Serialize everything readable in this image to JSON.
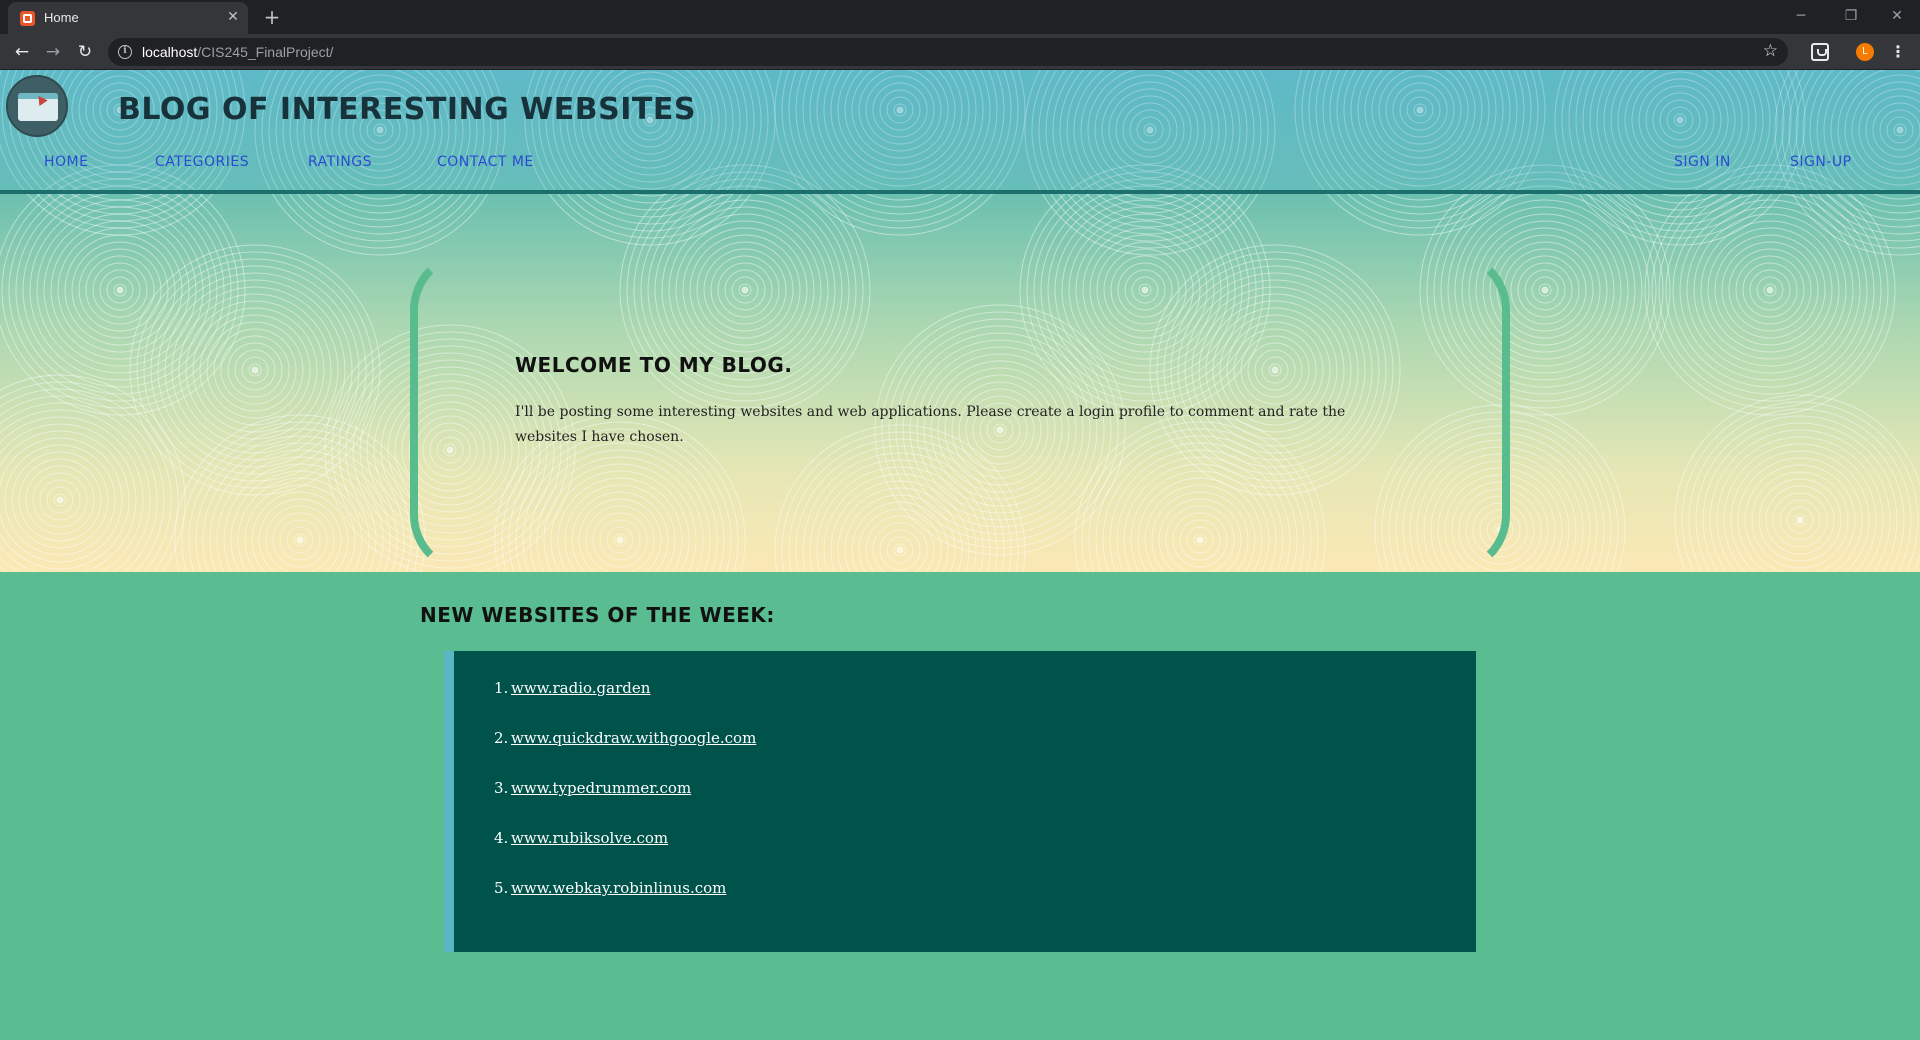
{
  "browser": {
    "tab_title": "Home",
    "tab_close": "✕",
    "new_tab": "+",
    "url_host": "localhost",
    "url_path": "/CIS245_FinalProject/",
    "profile_initial": "L",
    "win_minimize": "─",
    "win_restore": "❐",
    "win_close": "✕",
    "icons": {
      "back": "←",
      "forward": "→",
      "reload": "↻",
      "info": "i",
      "star": "☆",
      "menu": "⋮"
    }
  },
  "site": {
    "title": "BLOG OF INTERESTING WEBSITES",
    "nav_left": [
      "HOME",
      "CATEGORIES",
      "RATINGS",
      "CONTACT ME"
    ],
    "nav_right": [
      "SIGN IN",
      "SIGN-UP"
    ]
  },
  "welcome": {
    "heading": "WELCOME TO MY BLOG.",
    "text": "I'll be posting some interesting websites and web applications. Please create a login profile to comment and rate the websites I have chosen."
  },
  "new_sites": {
    "heading": "NEW WEBSITES OF THE WEEK:",
    "items": [
      {
        "num": "1.",
        "url": "www.radio.garden"
      },
      {
        "num": "2.",
        "url": "www.quickdraw.withgoogle.com"
      },
      {
        "num": "3.",
        "url": "www.typedrummer.com"
      },
      {
        "num": "4.",
        "url": "www.rubiksolve.com"
      },
      {
        "num": "5.",
        "url": "www.webkay.robinlinus.com"
      }
    ]
  },
  "colors": {
    "page_green": "#5abd91",
    "list_bg": "#00534a",
    "list_accent": "#5ab6c4",
    "nav_link": "#2b4bd1",
    "header_rule": "#1c6f6c"
  }
}
